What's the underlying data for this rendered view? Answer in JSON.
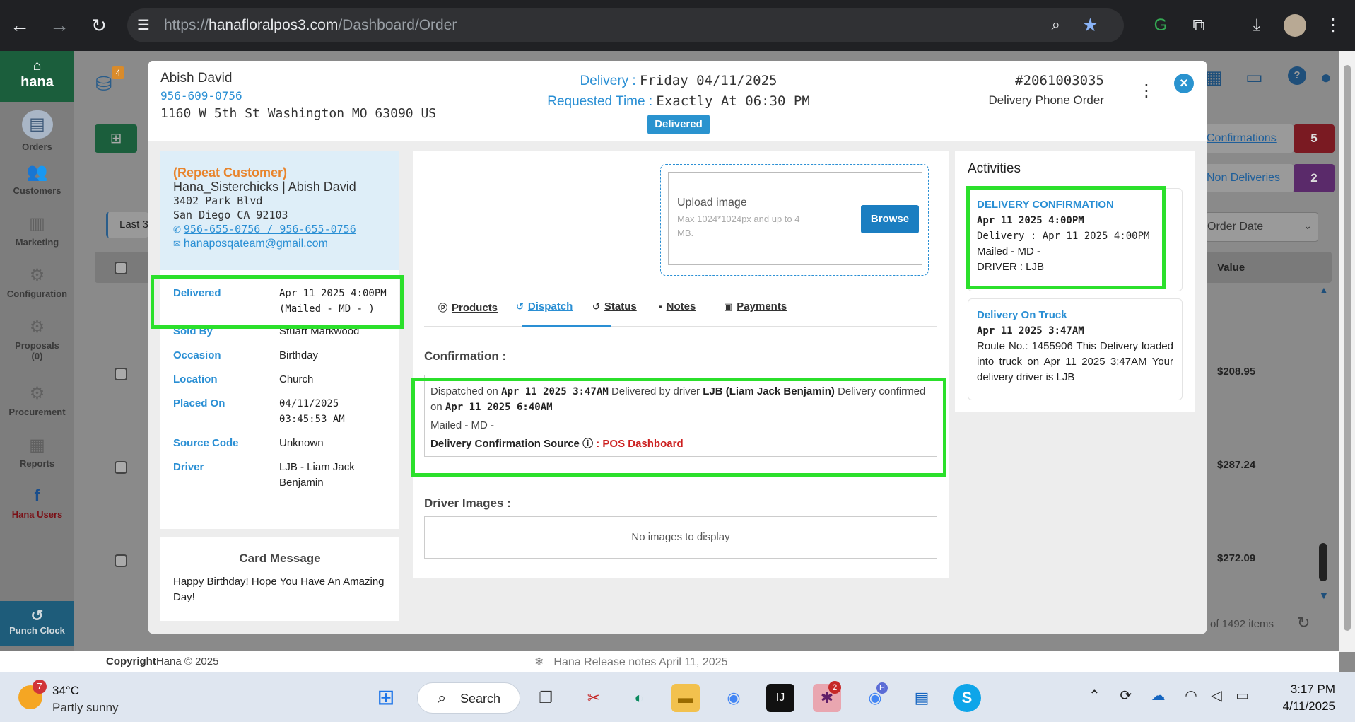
{
  "browser": {
    "url_host": "hanafloralpos3.com",
    "url_path": "/Dashboard/Order",
    "url_scheme": "https://"
  },
  "sidebar": {
    "logo": "hana",
    "items": [
      {
        "label": "Orders",
        "icon": "orders-icon"
      },
      {
        "label": "Customers",
        "icon": "customers-icon"
      },
      {
        "label": "Marketing",
        "icon": "marketing-icon"
      },
      {
        "label": "Configuration",
        "icon": "gear-icon"
      },
      {
        "label": "Proposals",
        "sub": "(0)",
        "icon": "proposals-icon"
      },
      {
        "label": "Procurement",
        "icon": "procurement-icon"
      },
      {
        "label": "Reports",
        "icon": "reports-icon"
      },
      {
        "label": "Hana Users",
        "icon": "facebook-icon"
      }
    ],
    "punch_clock": "Punch Clock"
  },
  "background": {
    "confirmations": "Confirmations",
    "confirmations_count": "5",
    "non_deliveries": "Non Deliveries",
    "non_deliveries_count": "2",
    "order_date": "Order Date",
    "last": "Last 3",
    "value_header": "Value",
    "values": [
      "$208.95",
      "$287.24",
      "$272.09"
    ],
    "items_text": "of 1492 items",
    "notif_count": "4"
  },
  "modal": {
    "customer_name": "Abish David",
    "customer_phone": "956-609-0756",
    "customer_address": "1160 W 5th St Washington MO 63090 US",
    "delivery_label": "Delivery :",
    "delivery_date": "Friday 04/11/2025",
    "requested_label": "Requested Time :",
    "requested_time": "Exactly At 06:30 PM",
    "status": "Delivered",
    "order_number": "#2061003035",
    "order_type": "Delivery Phone Order"
  },
  "recipient": {
    "repeat": "(Repeat Customer)",
    "name": "Hana_Sisterchicks | Abish David",
    "address1": "3402 Park Blvd",
    "address2": "San Diego CA 92103",
    "phones": "956-655-0756 / 956-655-0756",
    "email": "hanaposqateam@gmail.com"
  },
  "details": [
    {
      "key": "Delivered",
      "value": "Apr 11 2025 4:00PM (Mailed - MD - )"
    },
    {
      "key": "Sold By",
      "value": "Stuart Markwood"
    },
    {
      "key": "Occasion",
      "value": "Birthday"
    },
    {
      "key": "Location",
      "value": "Church"
    },
    {
      "key": "Placed On",
      "value": "04/11/2025 03:45:53 AM"
    },
    {
      "key": "Source Code",
      "value": "Unknown"
    },
    {
      "key": "Driver",
      "value": "LJB - Liam Jack Benjamin"
    }
  ],
  "card": {
    "title": "Card Message",
    "message": "Happy Birthday! Hope You Have An Amazing Day!"
  },
  "upload": {
    "title": "Upload image",
    "hint": "Max 1024*1024px and up to 4 MB.",
    "browse": "Browse"
  },
  "tabs": [
    "Products",
    "Dispatch",
    "Status",
    "Notes",
    "Payments"
  ],
  "dispatch": {
    "confirmation_label": "Confirmation :",
    "t1": "Dispatched on ",
    "dispatched_on": "Apr 11 2025 3:47AM",
    "t2": " Delivered by driver ",
    "driver": "LJB (Liam Jack Benjamin)",
    "t3": " Delivery confirmed on ",
    "confirmed_on": "Apr 11 2025 6:40AM",
    "mailed": "Mailed - MD -",
    "source_label": "Delivery Confirmation Source",
    "source_value": ": POS Dashboard",
    "driver_images_label": "Driver Images :",
    "no_images": "No images to display"
  },
  "activities": {
    "title": "Activities",
    "items": [
      {
        "heading": "DELIVERY CONFIRMATION",
        "date": "Apr 11 2025 4:00PM",
        "lines": [
          "Delivery : Apr 11 2025 4:00PM",
          "Mailed - MD -",
          "DRIVER : LJB"
        ]
      },
      {
        "heading": "Delivery On Truck",
        "date": "Apr 11 2025 3:47AM",
        "lines": [
          "Route No.: 1455906 This Delivery loaded into truck on Apr 11 2025 3:47AM Your delivery driver is LJB"
        ]
      }
    ]
  },
  "footer": {
    "copyright_bold": "Copyright",
    "copyright": "Hana © 2025",
    "release": "Hana Release notes April 11, 2025"
  },
  "taskbar": {
    "temp": "34°C",
    "weather": "Partly sunny",
    "weather_badge": "7",
    "search": "Search",
    "slack_badge": "2",
    "chrome_profile": "H",
    "time": "3:17 PM",
    "date": "4/11/2025"
  },
  "colors": {
    "accent": "#2a8fd4",
    "highlight": "#2be02b",
    "status_delivered": "#2a93cf",
    "repeat_customer": "#e8842c",
    "source_red": "#cc1f1f"
  }
}
